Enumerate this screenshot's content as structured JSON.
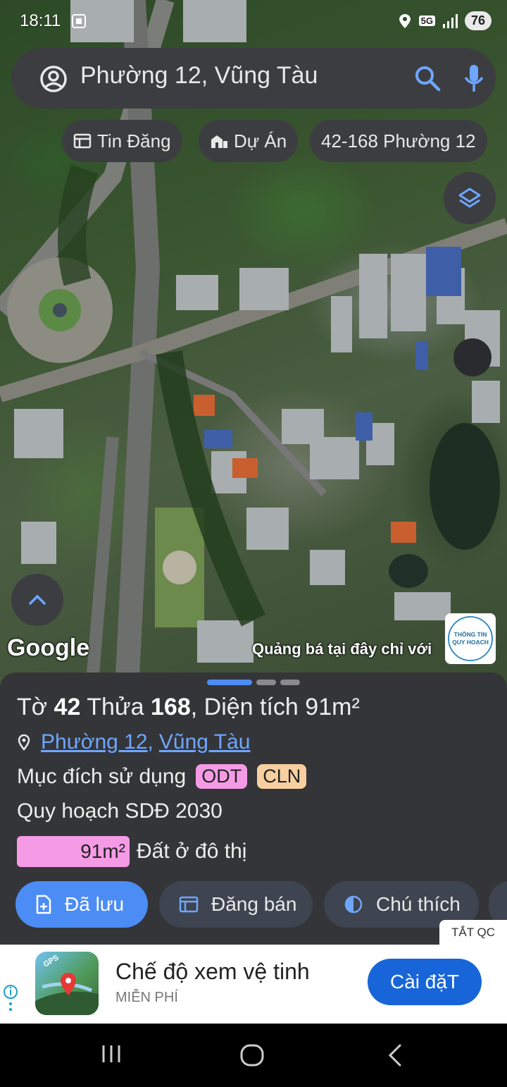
{
  "status_bar": {
    "time": "18:11",
    "network": "5G",
    "battery": "76"
  },
  "search": {
    "query": "Phường 12, Vũng Tàu"
  },
  "chips": [
    {
      "label": "Tin Đăng",
      "icon": "listing-icon"
    },
    {
      "label": "Dự Án",
      "icon": "buildings-icon"
    },
    {
      "label": "42-168 Phường 12",
      "icon": ""
    }
  ],
  "map": {
    "attribution": "Google",
    "promo_text": "Quảng bá tại đây chỉ với",
    "promo_logo_line1": "THÔNG TIN",
    "promo_logo_line2": "QUY HOẠCH"
  },
  "parcel": {
    "sheet_prefix": "Tờ",
    "sheet_number": "42",
    "lot_prefix": "Thửa",
    "lot_number": "168",
    "area_prefix": "Diện tích",
    "area_value": "91m²",
    "ward": "Phường 12",
    "city": "Vũng Tàu",
    "purpose_label": "Mục đích sử dụng",
    "purpose_tags": [
      "ODT",
      "CLN"
    ],
    "plan_label": "Quy hoạch SDĐ 2030",
    "plan_area": "91m²",
    "plan_area_fraction": 1.0,
    "plan_area_desc": "Đất ở đô thị",
    "colors": {
      "odt": "#f59be6",
      "cln": "#f8cfa0"
    }
  },
  "actions": [
    {
      "label": "Đã lưu",
      "icon": "save-icon"
    },
    {
      "label": "Đăng bán",
      "icon": "listing-icon"
    },
    {
      "label": "Chú thích",
      "icon": "contrast-icon"
    }
  ],
  "ad": {
    "close_label": "TẮT QC",
    "title": "Chế độ xem vệ tinh",
    "subtitle": "MIỄN PHÍ",
    "install_label": "Cài đặT",
    "icon_badge": "GPS"
  },
  "theme": {
    "accent": "#4c8cf5",
    "panel": "#343538",
    "install": "#1765d8"
  }
}
